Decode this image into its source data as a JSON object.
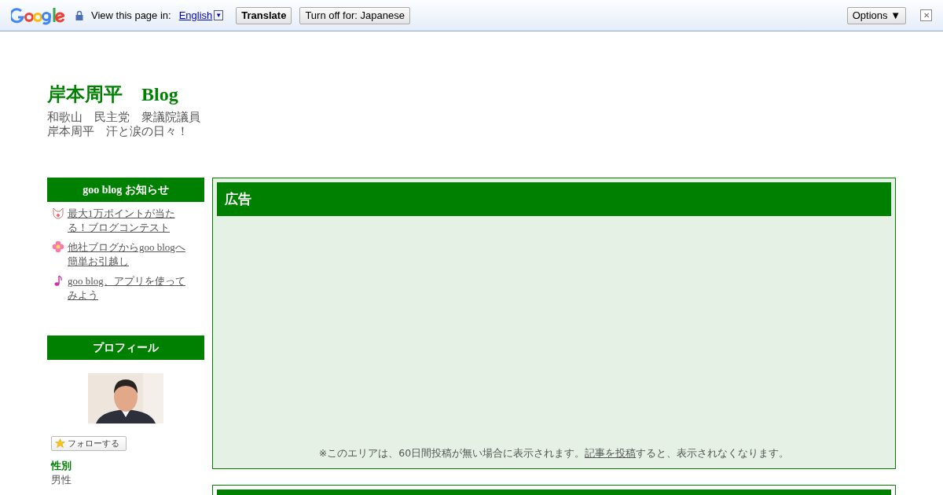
{
  "translate_bar": {
    "prompt": "View this page in:",
    "language": "English",
    "language_dropdown": "▼",
    "translate_button": "Translate",
    "turn_off_button": "Turn off for: Japanese",
    "options_button": "Options ▼",
    "close": "✕"
  },
  "blog": {
    "title": "岸本周平　Blog",
    "description_lines": [
      "和歌山　民主党　衆議院議員",
      "岸本周平　汗と涙の日々！"
    ]
  },
  "notice_box": {
    "title": "goo blog お知らせ",
    "items": [
      {
        "kind": "fox",
        "text": "最大1万ポイントが当たる！ブログコンテスト"
      },
      {
        "kind": "flower",
        "text": "他社ブログからgoo blogへ簡単お引越し"
      },
      {
        "kind": "note",
        "text": "goo blog、アプリを使ってみよう"
      }
    ]
  },
  "profile": {
    "title": "プロフィール",
    "follow_button": "フォローする",
    "fields": [
      {
        "label": "性別",
        "value": "男性"
      }
    ]
  },
  "ad_panel": {
    "title": "広告",
    "note_before": "※このエリアは、60日間投稿が無い場合に表示されます。",
    "note_link": "記事を投稿",
    "note_after": "すると、表示されなくなります。"
  }
}
